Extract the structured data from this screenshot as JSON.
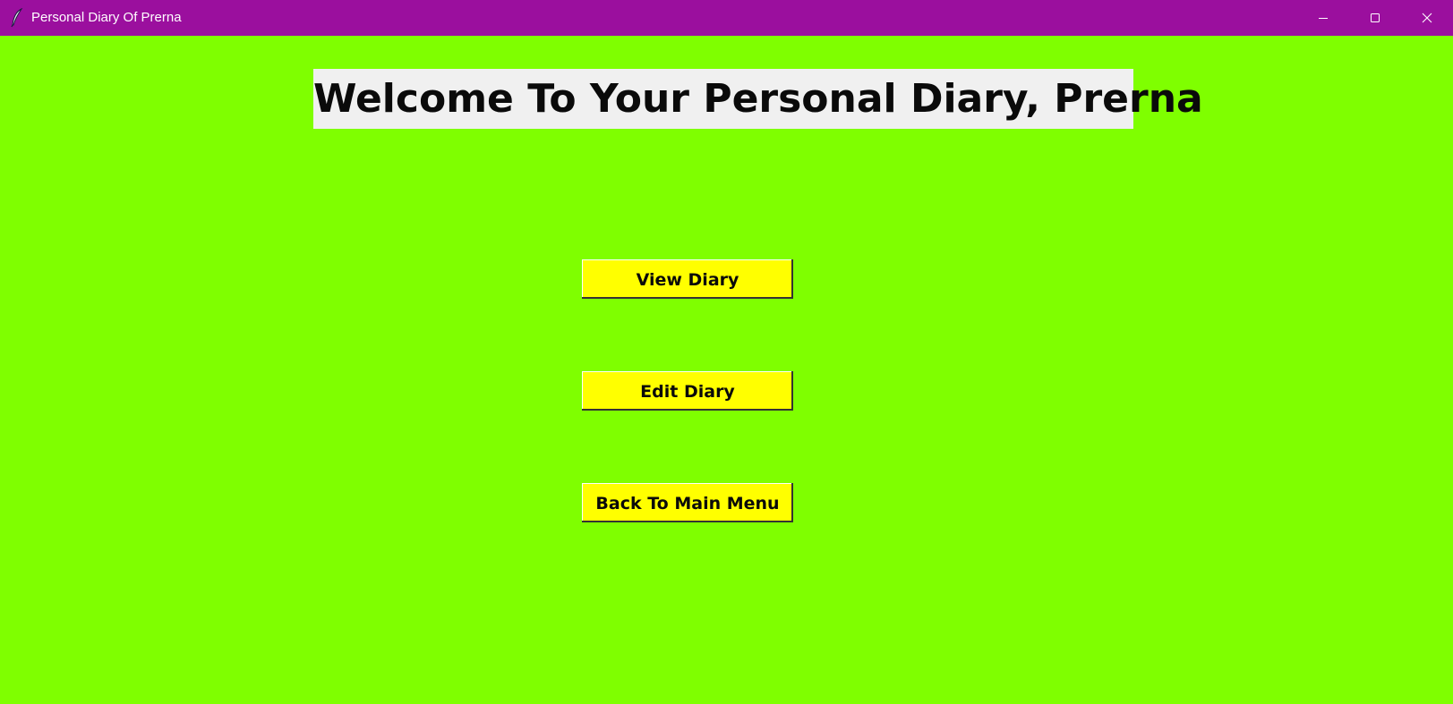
{
  "window": {
    "title": "Personal Diary Of Prerna",
    "icon": "feather-icon",
    "titlebar_color": "#9b0f9e",
    "background_color": "#7fff00",
    "controls": {
      "minimize_icon": "minimize-icon",
      "maximize_icon": "maximize-icon",
      "close_icon": "close-icon"
    }
  },
  "main": {
    "heading": "Welcome To Your Personal Diary, Prerna",
    "heading_background": "#f0f0f0",
    "button_color": "#ffff00",
    "buttons": [
      {
        "label": "View Diary"
      },
      {
        "label": "Edit Diary"
      },
      {
        "label": "Back To Main Menu"
      }
    ]
  }
}
